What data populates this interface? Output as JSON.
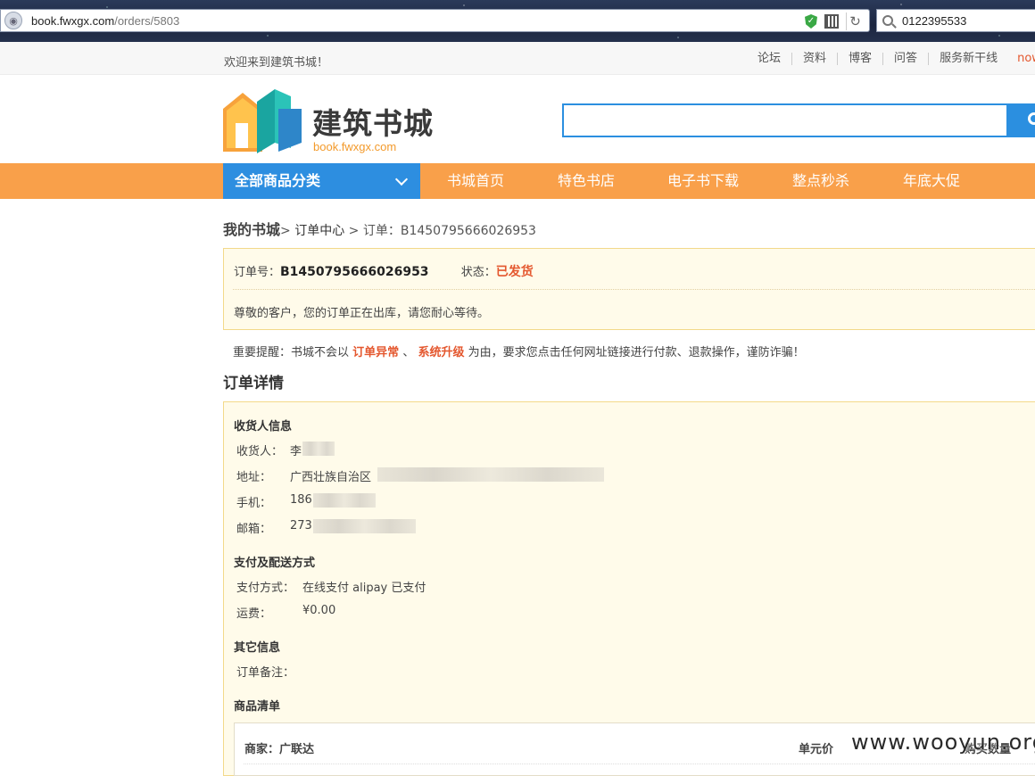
{
  "browser": {
    "url_host": "book.fwxgx.com",
    "url_path": "/orders/5803",
    "search_query": "0122395533"
  },
  "topbar": {
    "welcome": "欢迎来到建筑书城！",
    "links": [
      "论坛",
      "资料",
      "博客",
      "问答",
      "服务新干线"
    ],
    "extra": "now"
  },
  "header": {
    "logo_title": "建筑书城",
    "logo_domain": "book.fwxgx.com",
    "search_value": ""
  },
  "nav": {
    "category_label": "全部商品分类",
    "items": [
      "书城首页",
      "特色书店",
      "电子书下载",
      "整点秒杀",
      "年底大促"
    ]
  },
  "breadcrumb": {
    "home": "我的书城",
    "sep1": ">",
    "section": "订单中心",
    "sep2": ">",
    "current": "订单：B1450795666026953"
  },
  "order": {
    "number_label": "订单号：",
    "number": "B1450795666026953",
    "status_label": "状态：",
    "status": "已发货",
    "message": "尊敬的客户，您的订单正在出库，请您耐心等待。"
  },
  "notice": {
    "prefix": "重要提醒：书城不会以",
    "kw1": "订单异常",
    "mid": "、",
    "kw2": "系统升级",
    "suffix": "为由，要求您点击任何网址链接进行付款、退款操作，谨防诈骗！"
  },
  "detail": {
    "title": "订单详情",
    "receiver_section": "收货人信息",
    "receiver_name_label": "收货人：",
    "receiver_name": "李",
    "address_label": "地址：",
    "address": "广西壮族自治区",
    "phone_label": "手机：",
    "phone": "186",
    "email_label": "邮箱：",
    "email": "273",
    "payment_section": "支付及配送方式",
    "payment_label": "支付方式：",
    "payment_value": "在线支付 alipay 已支付",
    "shipping_label": "运费：",
    "shipping_value": "¥0.00",
    "other_section": "其它信息",
    "remark_label": "订单备注：",
    "goods_section": "商品清单",
    "seller_label": "商家：广联达",
    "price_header": "单元价",
    "qty_header": "购买数量"
  },
  "watermark": "www.wooyun.org",
  "colors": {
    "nav_orange": "#f9a04a",
    "category_blue": "#2d8ee0",
    "status_red": "#e4572e",
    "panel_bg": "#fffbea"
  }
}
